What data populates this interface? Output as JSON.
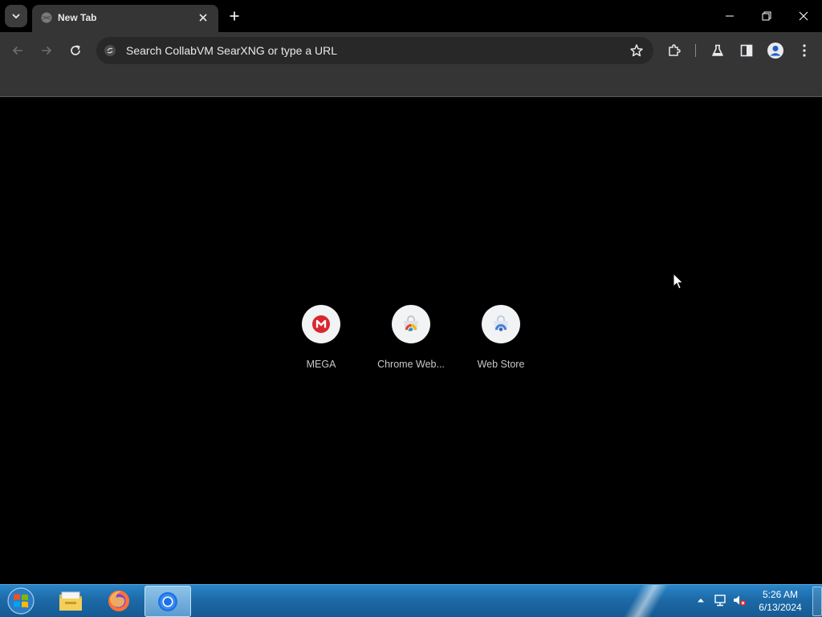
{
  "browser": {
    "tab": {
      "title": "New Tab"
    },
    "omnibox": {
      "placeholder": "Search CollabVM SearXNG or type a URL"
    }
  },
  "shortcuts": [
    {
      "label": "MEGA",
      "icon": "mega-icon"
    },
    {
      "label": "Chrome Web...",
      "icon": "chrome-web-store-icon"
    },
    {
      "label": "Web Store",
      "icon": "web-store-icon"
    }
  ],
  "taskbar": {
    "pinned": [
      "start-orb",
      "file-explorer",
      "firefox",
      "chrome"
    ],
    "clock": {
      "time": "5:26 AM",
      "date": "6/13/2024"
    }
  },
  "colors": {
    "mega_red": "#d9272e",
    "toolbar_bg": "#353535",
    "taskbar_blue": "#1d6aa8"
  }
}
